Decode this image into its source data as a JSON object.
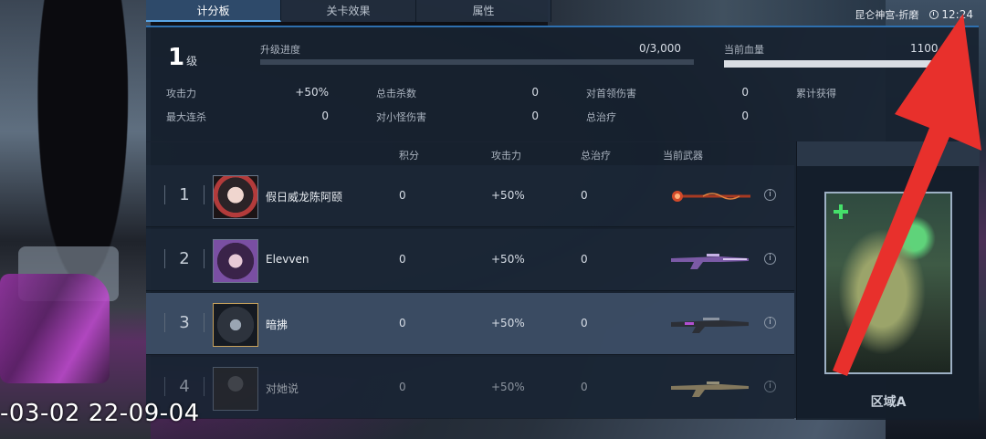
{
  "tabs": [
    {
      "label": "计分板",
      "active": true
    },
    {
      "label": "关卡效果",
      "active": false
    },
    {
      "label": "属性",
      "active": false
    }
  ],
  "topbar": {
    "location": "昆仑神宫-折磨",
    "time": "12:24"
  },
  "level": {
    "number": "1",
    "unit": "级"
  },
  "upgrade": {
    "label": "升级进度",
    "value": "0/3,000",
    "progress": 0
  },
  "hp": {
    "label": "当前血量",
    "value": "1100",
    "fraction": 1.0
  },
  "stats": [
    {
      "label": "攻击力",
      "value": "+50%"
    },
    {
      "label": "最大连杀",
      "value": "0"
    },
    {
      "label": "总击杀数",
      "value": "0"
    },
    {
      "label": "对小怪伤害",
      "value": "0"
    },
    {
      "label": "对首领伤害",
      "value": "0"
    },
    {
      "label": "总治疗",
      "value": "0"
    },
    {
      "label": "累计获得",
      "value": ""
    }
  ],
  "table": {
    "headers": [
      "积分",
      "攻击力",
      "总治疗",
      "当前武器"
    ],
    "rows": [
      {
        "rank": "1",
        "name": "假日威龙陈阿颐",
        "score": "0",
        "attack": "+50%",
        "heal": "0",
        "weapon": "staff"
      },
      {
        "rank": "2",
        "name": "Elevven",
        "score": "0",
        "attack": "+50%",
        "heal": "0",
        "weapon": "rifle-purple"
      },
      {
        "rank": "3",
        "name": "暗拂",
        "score": "0",
        "attack": "+50%",
        "heal": "0",
        "weapon": "rifle-dark"
      },
      {
        "rank": "4",
        "name": "对她说",
        "score": "0",
        "attack": "+50%",
        "heal": "0",
        "weapon": "rifle-gold"
      }
    ]
  },
  "card": {
    "label": "区域A"
  },
  "overlay": {
    "timestamp": "-03-02 22-09-04"
  },
  "colors": {
    "accent": "#2e6fae",
    "arrow": "#e8302c"
  }
}
